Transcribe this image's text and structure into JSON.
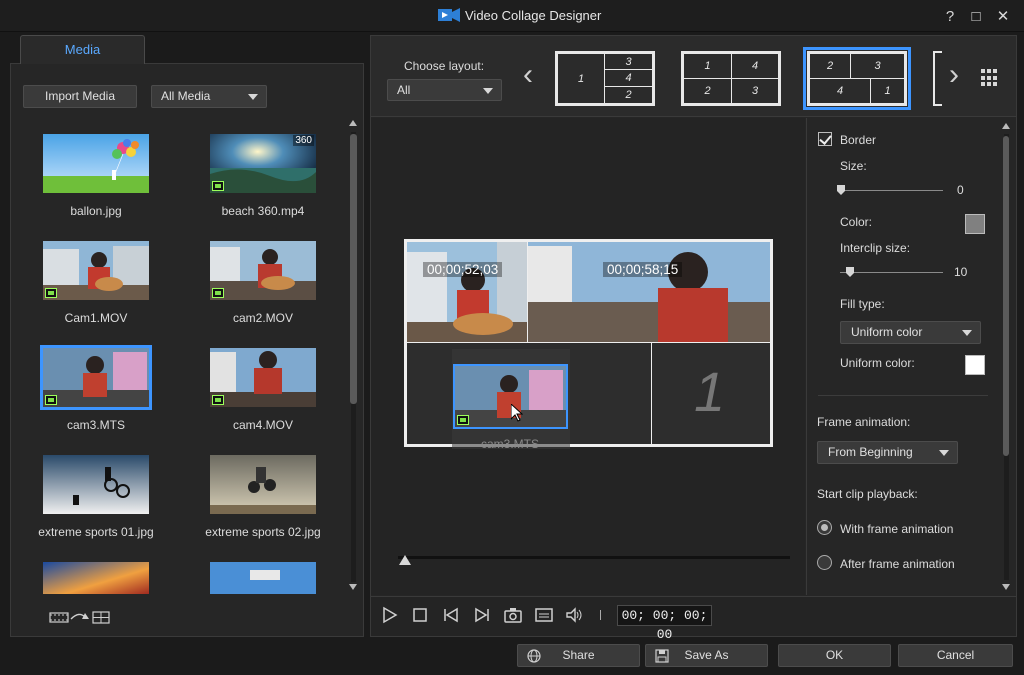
{
  "window": {
    "title": "Video Collage Designer",
    "controls": [
      "?",
      "□",
      "✕"
    ]
  },
  "media_panel": {
    "tab_label": "Media",
    "import_label": "Import Media",
    "filter_value": "All Media",
    "items": [
      {
        "name": "ballon.jpg",
        "kind": "image",
        "badge": ""
      },
      {
        "name": "beach 360.mp4",
        "kind": "video",
        "badge": "360"
      },
      {
        "name": "Cam1.MOV",
        "kind": "video",
        "badge": ""
      },
      {
        "name": "cam2.MOV",
        "kind": "video",
        "badge": ""
      },
      {
        "name": "cam3.MTS",
        "kind": "video",
        "badge": "",
        "selected": true
      },
      {
        "name": "cam4.MOV",
        "kind": "video",
        "badge": ""
      },
      {
        "name": "extreme sports 01.jpg",
        "kind": "image",
        "badge": ""
      },
      {
        "name": "extreme sports 02.jpg",
        "kind": "image",
        "badge": ""
      },
      {
        "name": "",
        "kind": "image",
        "badge": ""
      },
      {
        "name": "",
        "kind": "image",
        "badge": ""
      }
    ]
  },
  "layout_picker": {
    "label": "Choose layout:",
    "filter_value": "All",
    "options": [
      {
        "cells": [
          "1",
          "3",
          "4",
          "2"
        ]
      },
      {
        "cells": [
          "1",
          "4",
          "2",
          "3"
        ]
      },
      {
        "cells": [
          "2",
          "3",
          "4",
          "1"
        ],
        "selected": true
      }
    ]
  },
  "collage": {
    "cells": [
      {
        "slot": "cell-1",
        "timecode": "00;00;52;03"
      },
      {
        "slot": "cell-2",
        "timecode": "00;00;58;15"
      },
      {
        "slot": "cell-3",
        "timecode": ""
      },
      {
        "slot": "cell-4",
        "placeholder": "1"
      }
    ],
    "drag_label": "cam3.MTS"
  },
  "playback": {
    "time": "00; 00; 00; 00",
    "position": 0.0
  },
  "properties": {
    "border_label": "Border",
    "border_checked": true,
    "size_label": "Size:",
    "size_value": "0",
    "color_label": "Color:",
    "border_color": "#808080",
    "interclip_label": "Interclip size:",
    "interclip_value": "10",
    "fill_type_label": "Fill type:",
    "fill_type_value": "Uniform color",
    "uniform_color_label": "Uniform color:",
    "uniform_color": "#ffffff",
    "frame_animation_label": "Frame animation:",
    "frame_animation_value": "From Beginning",
    "start_playback_label": "Start clip playback:",
    "radio_with": "With frame animation",
    "radio_after": "After frame animation",
    "radio_selected": "with"
  },
  "footer": {
    "share_label": "Share",
    "save_as_label": "Save As",
    "ok_label": "OK",
    "cancel_label": "Cancel"
  },
  "colors": {
    "accent": "#3d95ff",
    "tab_text": "#5aa9ff",
    "background": "#1b1b1b"
  }
}
